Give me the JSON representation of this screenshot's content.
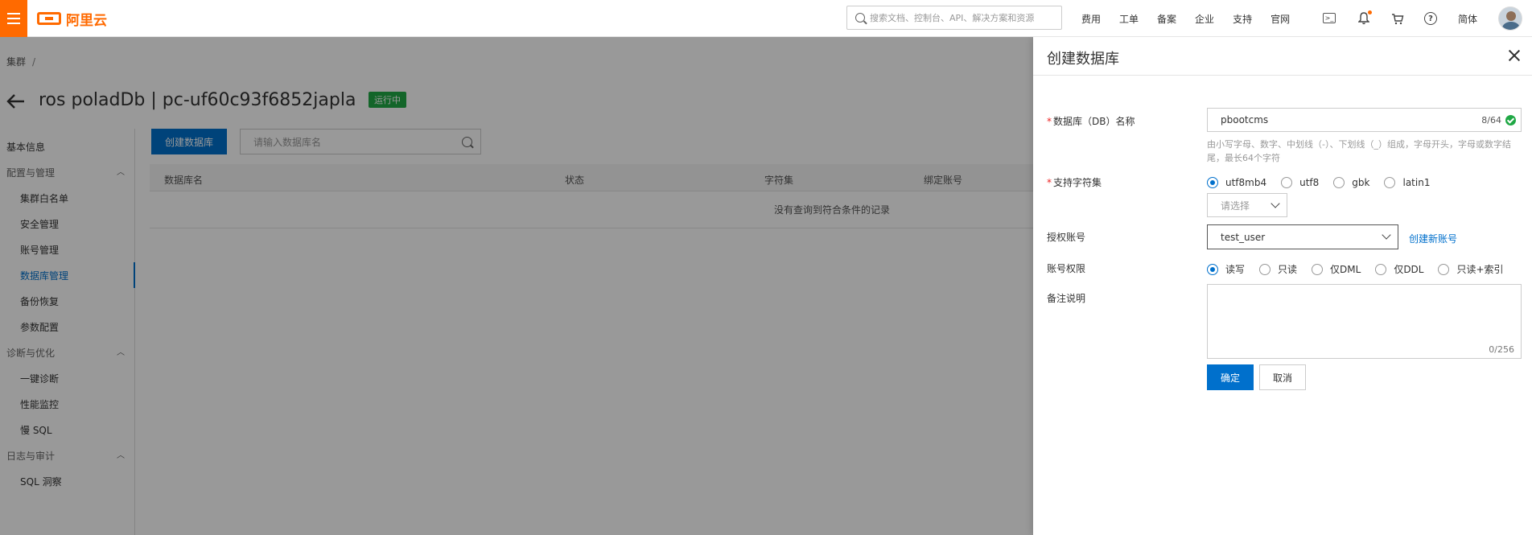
{
  "topbar": {
    "brand": "阿里云",
    "search_placeholder": "搜索文档、控制台、API、解决方案和资源",
    "nav": [
      "费用",
      "工单",
      "备案",
      "企业",
      "支持",
      "官网"
    ],
    "lang": "简体",
    "icons": [
      "menu-icon",
      "search-icon",
      "terminal-icon",
      "bell-icon",
      "cart-icon",
      "help-icon"
    ]
  },
  "page": {
    "breadcrumb": "集群",
    "breadcrumb_sep": "/",
    "title": "ros poladDb | pc-uf60c93f6852japla",
    "status": "运行中",
    "status_color": "#20a845"
  },
  "sidebar": {
    "items": [
      {
        "label": "基本信息"
      },
      {
        "label": "配置与管理"
      },
      {
        "label": "集群白名单"
      },
      {
        "label": "安全管理"
      },
      {
        "label": "账号管理"
      },
      {
        "label": "数据库管理"
      },
      {
        "label": "备份恢复"
      },
      {
        "label": "参数配置"
      },
      {
        "label": "诊断与优化"
      },
      {
        "label": "一键诊断"
      },
      {
        "label": "性能监控"
      },
      {
        "label": "慢 SQL"
      },
      {
        "label": "日志与审计"
      },
      {
        "label": "SQL 洞察"
      }
    ]
  },
  "main": {
    "create_button": "创建数据库",
    "search_placeholder": "请输入数据库名",
    "columns": [
      "数据库名",
      "状态",
      "字符集",
      "绑定账号"
    ],
    "empty_text": "没有查询到符合条件的记录"
  },
  "drawer": {
    "title": "创建数据库",
    "name_label": "数据库（DB）名称",
    "name_value": "pbootcms",
    "name_counter": "8/64",
    "name_hint": "由小写字母、数字、中划线（-）、下划线（_）组成，字母开头，字母或数字结尾，最长64个字符",
    "charset_label": "支持字符集",
    "charset_options": [
      "utf8mb4",
      "utf8",
      "gbk",
      "latin1"
    ],
    "charset_selected": "utf8mb4",
    "collation_placeholder": "请选择",
    "account_label": "授权账号",
    "account_value": "test_user",
    "create_account_link": "创建新账号",
    "privilege_label": "账号权限",
    "privilege_options": [
      "读写",
      "只读",
      "仅DML",
      "仅DDL",
      "只读+索引"
    ],
    "privilege_selected": "读写",
    "remark_label": "备注说明",
    "remark_counter": "0/256",
    "ok_button": "确定",
    "cancel_button": "取消",
    "accent_color": "#0070cc"
  }
}
